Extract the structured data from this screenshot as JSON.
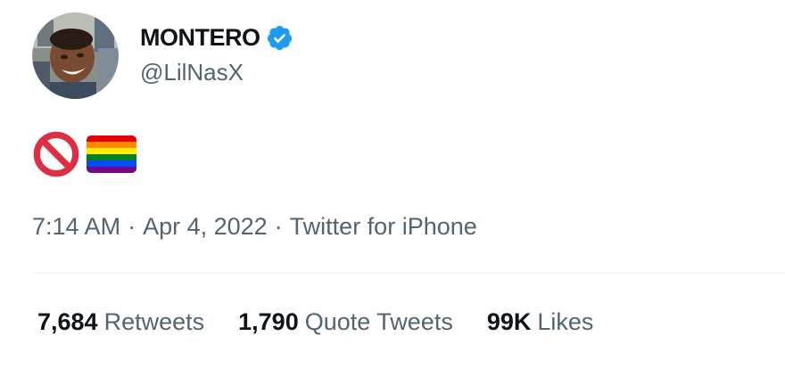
{
  "tweet": {
    "author": {
      "display_name": "MONTERO",
      "handle": "@LilNasX",
      "verified": true,
      "avatar_icon": "profile-photo"
    },
    "content": {
      "emojis": [
        "no-entry-sign-icon",
        "rainbow-flag-icon"
      ]
    },
    "meta": {
      "time": "7:14 AM",
      "separator": "·",
      "date": "Apr 4, 2022",
      "source": "Twitter for iPhone"
    },
    "stats": [
      {
        "count": "7,684",
        "label": "Retweets"
      },
      {
        "count": "1,790",
        "label": "Quote Tweets"
      },
      {
        "count": "99K",
        "label": "Likes"
      }
    ]
  },
  "colors": {
    "text_primary": "#0f1419",
    "text_secondary": "#536471",
    "verified_blue": "#1d9bf0",
    "divider": "#eff3f4",
    "prohibited_red": "#dd2e44"
  }
}
